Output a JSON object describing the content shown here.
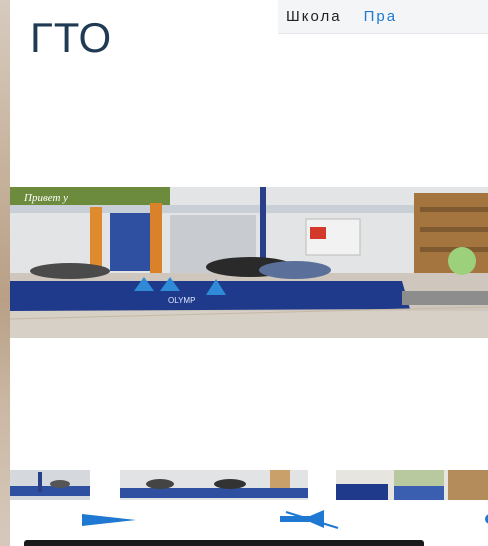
{
  "header": {
    "title": "ГТО"
  },
  "top_nav": {
    "school_label": "Школа",
    "right_link_label": "Пра"
  },
  "banner_text": "Привет у",
  "mat_brand": "OLYMP",
  "sign_text": "",
  "colors": {
    "title": "#1f3a52",
    "accent": "#1f78d1",
    "mat": "#1f3a8a"
  },
  "icons": {
    "play": "play-icon",
    "mute": "volume-mute-icon"
  }
}
